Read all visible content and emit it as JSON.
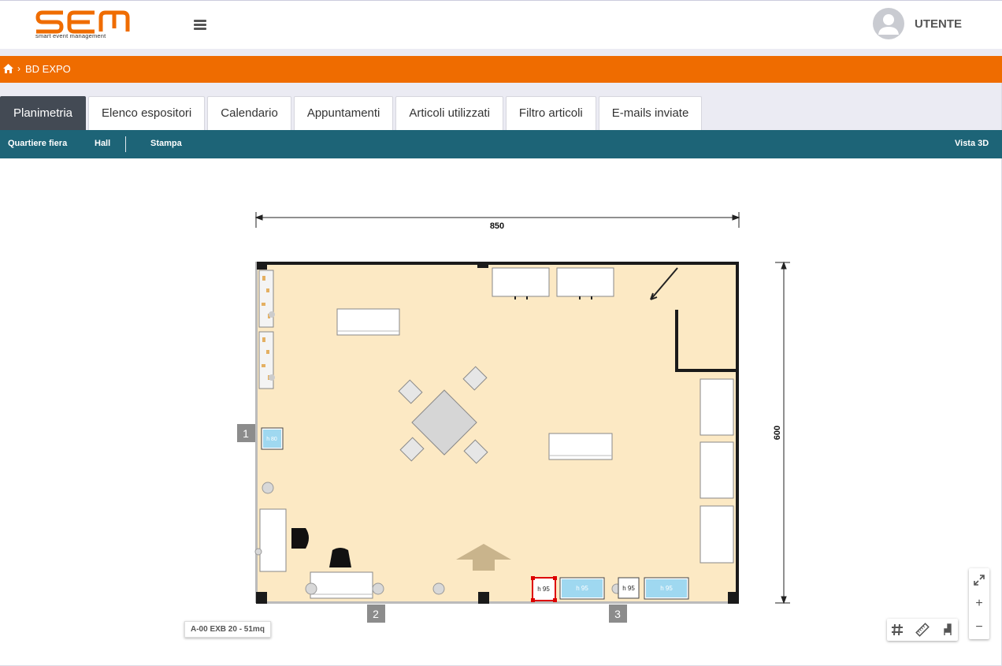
{
  "app": {
    "logo_text": "SEM",
    "logo_tagline": "smart event management",
    "user_label": "UTENTE",
    "brand_color": "#ef6c00"
  },
  "breadcrumb": {
    "home_icon": "home-icon",
    "separator": "›",
    "items": [
      "BD EXPO"
    ]
  },
  "tabs": [
    {
      "label": "Planimetria",
      "active": true
    },
    {
      "label": "Elenco espositori",
      "active": false
    },
    {
      "label": "Calendario",
      "active": false
    },
    {
      "label": "Appuntamenti",
      "active": false
    },
    {
      "label": "Articoli utilizzati",
      "active": false
    },
    {
      "label": "Filtro articoli",
      "active": false
    },
    {
      "label": "E-mails inviate",
      "active": false
    }
  ],
  "subnav": {
    "quartiere": "Quartiere fiera",
    "hall": "Hall",
    "stampa": "Stampa",
    "vista3d": "Vista 3D"
  },
  "floorplan": {
    "width_dimension": "850",
    "height_dimension": "600",
    "entrances": [
      "1",
      "2",
      "3"
    ],
    "height_tags": [
      "h 80",
      "h 95",
      "h 95",
      "h 95",
      "h 95"
    ],
    "stand_label": "A-00 EXB 20 - 51mq",
    "floor_color": "#fce9c4"
  },
  "toolbar": {
    "grid_icon": "grid-icon",
    "ruler_icon": "ruler-icon",
    "furniture_icon": "chair-icon",
    "expand_icon": "expand-icon",
    "zoom_in": "+",
    "zoom_out": "−"
  }
}
